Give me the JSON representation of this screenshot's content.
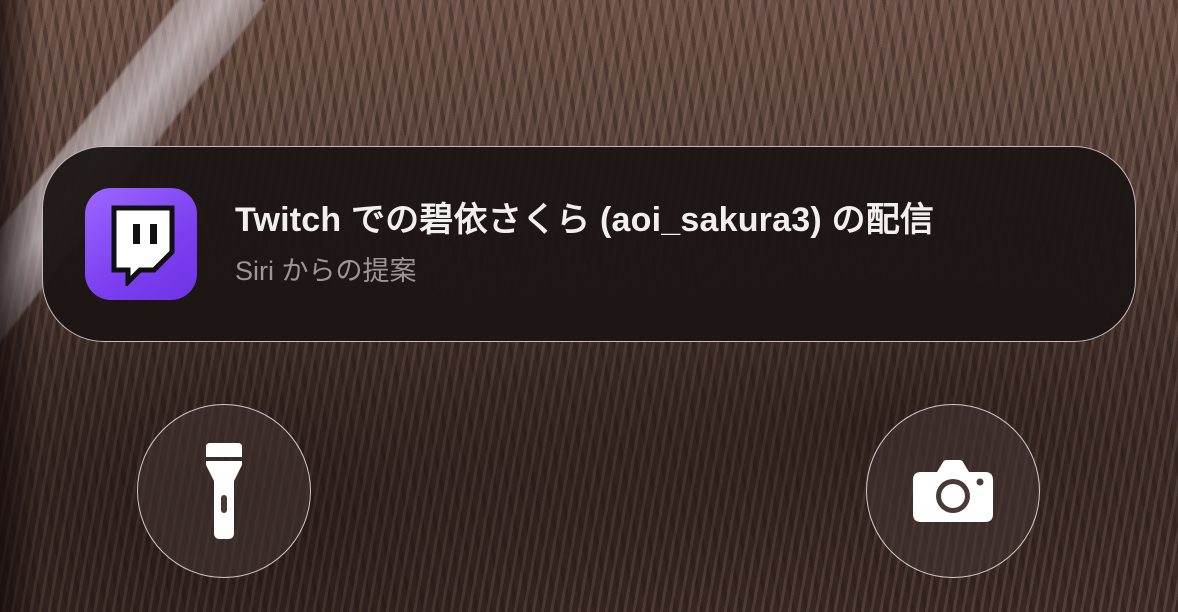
{
  "notification": {
    "title": "Twitch での碧依さくら (aoi_sakura3) の配信",
    "subtitle": "Siri からの提案",
    "app_icon": "twitch-icon",
    "app_icon_color": "#8b50f7"
  },
  "quick_actions": {
    "left_icon": "flashlight-icon",
    "right_icon": "camera-icon"
  }
}
